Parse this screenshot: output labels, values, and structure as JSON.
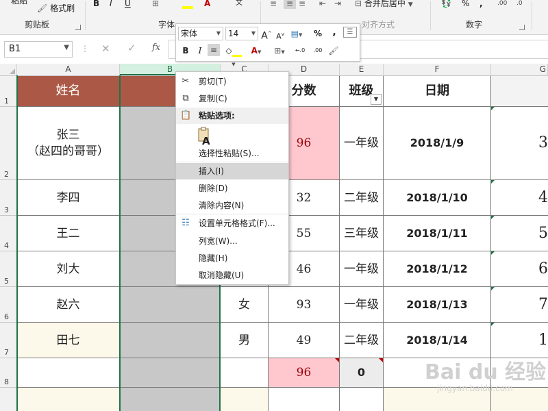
{
  "ribbon": {
    "paste_label": "粘贴",
    "format_painter_label": "格式刷",
    "merge_center_label": "合并后居中",
    "groups": [
      "剪贴板",
      "字体",
      "对齐方式",
      "数字"
    ],
    "percent": "%",
    "comma": ","
  },
  "namebox": {
    "value": "B1"
  },
  "formula": {
    "fx": "fx"
  },
  "mini_toolbar": {
    "font": "宋体",
    "size": "14",
    "grow": "A",
    "shrink": "A",
    "percent": "%",
    "comma": ","
  },
  "columns": [
    "A",
    "B",
    "C",
    "D",
    "E",
    "F",
    "G"
  ],
  "rows": [
    "1",
    "2",
    "3",
    "4",
    "5",
    "6",
    "7",
    "8"
  ],
  "table": {
    "header": {
      "name": "姓名",
      "score": "分数",
      "class": "班级",
      "date": "日期"
    },
    "body": [
      {
        "name": "张三\n（赵四的哥哥）",
        "gender": "",
        "score": "96",
        "class": "一年级",
        "date": "2018/1/9",
        "g": "3"
      },
      {
        "name": "李四",
        "gender": "",
        "score": "32",
        "class": "二年级",
        "date": "2018/1/10",
        "g": "4"
      },
      {
        "name": "王二",
        "gender": "",
        "score": "55",
        "class": "三年级",
        "date": "2018/1/11",
        "g": "5"
      },
      {
        "name": "刘大",
        "gender": "",
        "score": "46",
        "class": "一年级",
        "date": "2018/1/12",
        "g": "6"
      },
      {
        "name": "赵六",
        "gender": "女",
        "score": "93",
        "class": "一年级",
        "date": "2018/1/13",
        "g": "7"
      },
      {
        "name": "田七",
        "gender": "男",
        "score": "49",
        "class": "二年级",
        "date": "2018/1/14",
        "g": "1"
      },
      {
        "name": "",
        "gender": "",
        "score": "96",
        "class": "0",
        "date": "",
        "g": ""
      }
    ]
  },
  "context_menu": {
    "cut": "剪切(T)",
    "copy": "复制(C)",
    "paste_options": "粘贴选项:",
    "paste_special": "选择性粘贴(S)...",
    "insert": "插入(I)",
    "delete": "删除(D)",
    "clear": "清除内容(N)",
    "format_cells": "设置单元格格式(F)...",
    "col_width": "列宽(W)...",
    "hide": "隐藏(H)",
    "unhide": "取消隐藏(U)"
  },
  "watermark": {
    "text": "Bai du 经验",
    "url": "jingyan.baidu.com"
  },
  "colors": {
    "header_bg": "#ab5946",
    "highlight_pink": "#ffc7ce",
    "cream": "#fdf9ea",
    "accent_green": "#217346"
  }
}
